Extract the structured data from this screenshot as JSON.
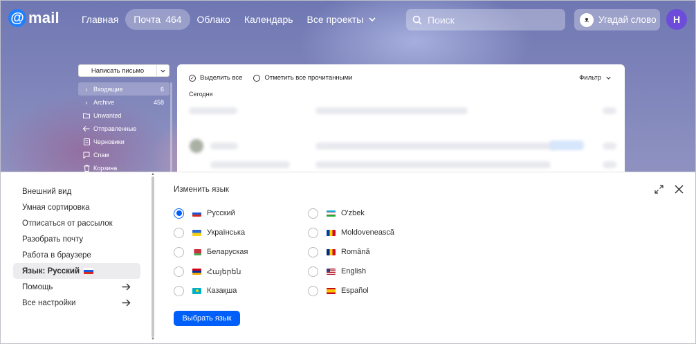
{
  "header": {
    "logo_text": "mail",
    "nav": [
      {
        "label": "Главная"
      },
      {
        "label": "Почта",
        "count": "464"
      },
      {
        "label": "Облако"
      },
      {
        "label": "Календарь"
      },
      {
        "label": "Все проекты"
      }
    ],
    "search_placeholder": "Поиск",
    "guess_label": "Угадай слово",
    "avatar_letter": "Н",
    "accent": "#005ff9"
  },
  "mail": {
    "compose_label": "Написать письмо",
    "folders": [
      {
        "icon": "chevron-right-icon",
        "label": "Входящие",
        "count": "6"
      },
      {
        "icon": "chevron-right-icon",
        "label": "Archive",
        "count": "458"
      },
      {
        "icon": "folder-icon",
        "label": "Unwanted",
        "count": ""
      },
      {
        "icon": "sent-icon",
        "label": "Отправленные",
        "count": ""
      },
      {
        "icon": "draft-icon",
        "label": "Черновики",
        "count": ""
      },
      {
        "icon": "spam-icon",
        "label": "Спам",
        "count": ""
      },
      {
        "icon": "trash-icon",
        "label": "Корзина",
        "count": ""
      }
    ],
    "select_all": "Выделить все",
    "mark_all_read": "Отметить все прочитанными",
    "filter": "Фильтр",
    "today": "Сегодня"
  },
  "settings": {
    "menu": [
      {
        "label": "Внешний вид"
      },
      {
        "label": "Умная сортировка"
      },
      {
        "label": "Отписаться от рассылок"
      },
      {
        "label": "Разобрать почту"
      },
      {
        "label": "Работа в браузере"
      },
      {
        "label": "Язык: Русский"
      },
      {
        "label": "Помощь"
      },
      {
        "label": "Все настройки"
      }
    ],
    "language_title": "Изменить язык",
    "languages_left": [
      {
        "label": "Русский",
        "flag": "ru",
        "selected": true
      },
      {
        "label": "Українська",
        "flag": "ua",
        "selected": false
      },
      {
        "label": "Беларуская",
        "flag": "by",
        "selected": false
      },
      {
        "label": "Հայերեն",
        "flag": "am",
        "selected": false
      },
      {
        "label": "Казақша",
        "flag": "kz",
        "selected": false
      }
    ],
    "languages_right": [
      {
        "label": "O'zbek",
        "flag": "uz",
        "selected": false
      },
      {
        "label": "Moldovenească",
        "flag": "md",
        "selected": false
      },
      {
        "label": "Română",
        "flag": "ro",
        "selected": false
      },
      {
        "label": "English",
        "flag": "us",
        "selected": false
      },
      {
        "label": "Español",
        "flag": "es",
        "selected": false
      }
    ],
    "choose_button": "Выбрать язык"
  }
}
